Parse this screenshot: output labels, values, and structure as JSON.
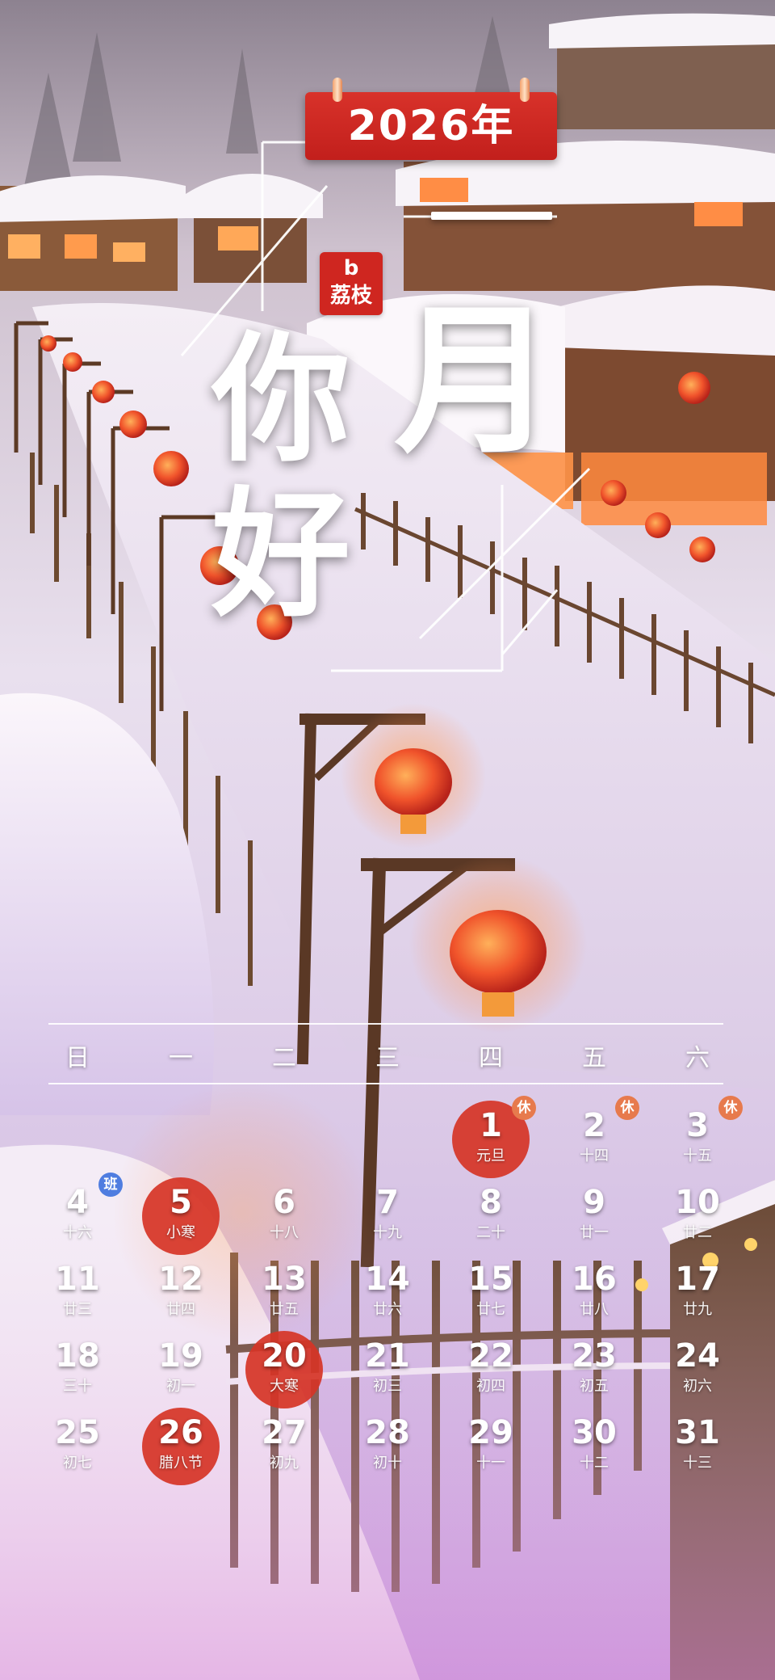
{
  "year_banner": "2026年",
  "logo": {
    "top": "b",
    "text": "荔枝"
  },
  "greeting": {
    "ni": "你",
    "hao": "好",
    "yi": "一",
    "yue": "月"
  },
  "colors": {
    "banner_red": "#cf2620",
    "holiday_circle": "#d63426",
    "rest_badge": "#e77a4d",
    "work_badge": "#4f7de0"
  },
  "calendar": {
    "weekdays": [
      "日",
      "一",
      "二",
      "三",
      "四",
      "五",
      "六"
    ],
    "start_weekday_index": 4,
    "days": [
      {
        "n": "1",
        "lunar": "元旦",
        "highlight": true,
        "badge": "休"
      },
      {
        "n": "2",
        "lunar": "十四",
        "highlight": false,
        "badge": "休"
      },
      {
        "n": "3",
        "lunar": "十五",
        "highlight": false,
        "badge": "休"
      },
      {
        "n": "4",
        "lunar": "十六",
        "highlight": false,
        "badge": "班"
      },
      {
        "n": "5",
        "lunar": "小寒",
        "highlight": true,
        "badge": ""
      },
      {
        "n": "6",
        "lunar": "十八",
        "highlight": false,
        "badge": ""
      },
      {
        "n": "7",
        "lunar": "十九",
        "highlight": false,
        "badge": ""
      },
      {
        "n": "8",
        "lunar": "二十",
        "highlight": false,
        "badge": ""
      },
      {
        "n": "9",
        "lunar": "廿一",
        "highlight": false,
        "badge": ""
      },
      {
        "n": "10",
        "lunar": "廿二",
        "highlight": false,
        "badge": ""
      },
      {
        "n": "11",
        "lunar": "廿三",
        "highlight": false,
        "badge": ""
      },
      {
        "n": "12",
        "lunar": "廿四",
        "highlight": false,
        "badge": ""
      },
      {
        "n": "13",
        "lunar": "廿五",
        "highlight": false,
        "badge": ""
      },
      {
        "n": "14",
        "lunar": "廿六",
        "highlight": false,
        "badge": ""
      },
      {
        "n": "15",
        "lunar": "廿七",
        "highlight": false,
        "badge": ""
      },
      {
        "n": "16",
        "lunar": "廿八",
        "highlight": false,
        "badge": ""
      },
      {
        "n": "17",
        "lunar": "廿九",
        "highlight": false,
        "badge": ""
      },
      {
        "n": "18",
        "lunar": "三十",
        "highlight": false,
        "badge": ""
      },
      {
        "n": "19",
        "lunar": "初一",
        "highlight": false,
        "badge": ""
      },
      {
        "n": "20",
        "lunar": "大寒",
        "highlight": true,
        "badge": ""
      },
      {
        "n": "21",
        "lunar": "初三",
        "highlight": false,
        "badge": ""
      },
      {
        "n": "22",
        "lunar": "初四",
        "highlight": false,
        "badge": ""
      },
      {
        "n": "23",
        "lunar": "初五",
        "highlight": false,
        "badge": ""
      },
      {
        "n": "24",
        "lunar": "初六",
        "highlight": false,
        "badge": ""
      },
      {
        "n": "25",
        "lunar": "初七",
        "highlight": false,
        "badge": ""
      },
      {
        "n": "26",
        "lunar": "腊八节",
        "highlight": true,
        "badge": ""
      },
      {
        "n": "27",
        "lunar": "初九",
        "highlight": false,
        "badge": ""
      },
      {
        "n": "28",
        "lunar": "初十",
        "highlight": false,
        "badge": ""
      },
      {
        "n": "29",
        "lunar": "十一",
        "highlight": false,
        "badge": ""
      },
      {
        "n": "30",
        "lunar": "十二",
        "highlight": false,
        "badge": ""
      },
      {
        "n": "31",
        "lunar": "十三",
        "highlight": false,
        "badge": ""
      }
    ]
  }
}
